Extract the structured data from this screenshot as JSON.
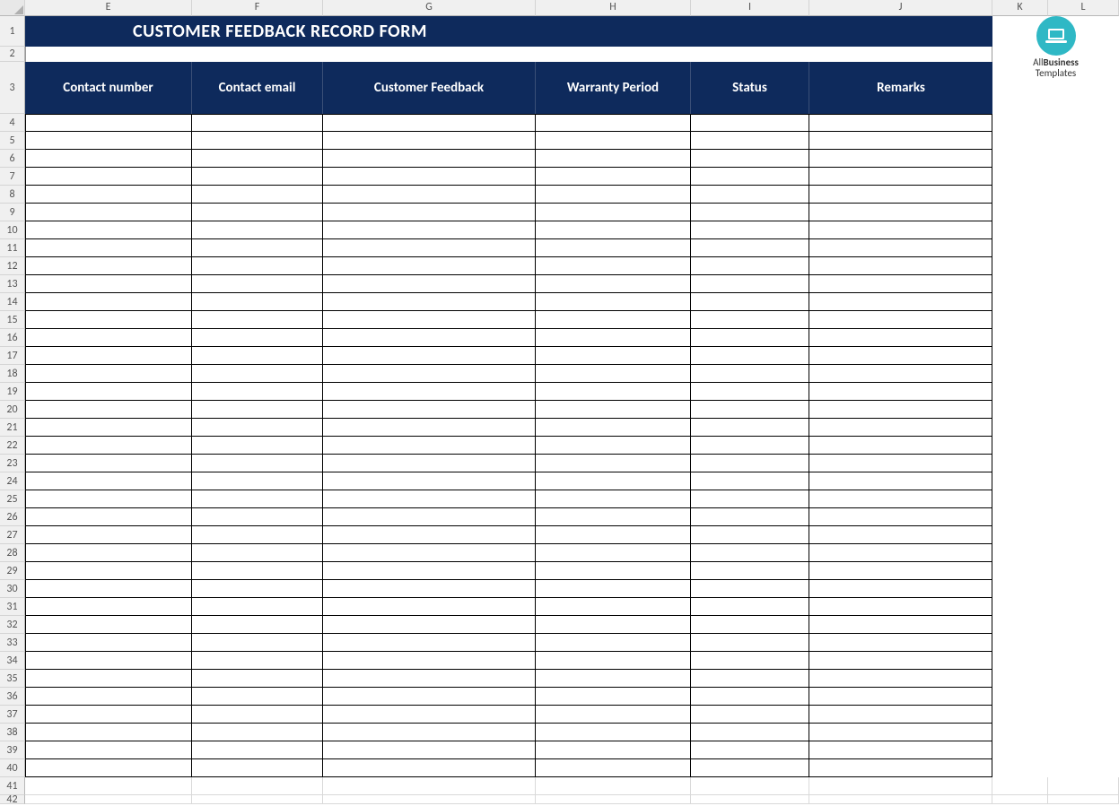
{
  "title": "CUSTOMER FEEDBACK RECORD FORM",
  "columns_letters": [
    "E",
    "F",
    "G",
    "H",
    "I",
    "J",
    "K",
    "L"
  ],
  "row_numbers": [
    "1",
    "2",
    "3",
    "4",
    "5",
    "6",
    "7",
    "8",
    "9",
    "10",
    "11",
    "12",
    "13",
    "14",
    "15",
    "16",
    "17",
    "18",
    "19",
    "20",
    "21",
    "22",
    "23",
    "24",
    "25",
    "26",
    "27",
    "28",
    "29",
    "30",
    "31",
    "32",
    "33",
    "34",
    "35",
    "36",
    "37",
    "38",
    "39",
    "40",
    "41",
    "42"
  ],
  "headers": {
    "contact_number": "Contact number",
    "contact_email": "Contact email",
    "customer_feedback": "Customer Feedback",
    "warranty_period": "Warranty Period",
    "status": "Status",
    "remarks": "Remarks"
  },
  "logo": {
    "line1a": "All",
    "line1b": "Business",
    "line2": "Templates"
  },
  "colors": {
    "brand_blue": "#0e2a5c",
    "logo_teal": "#2fb8c5"
  }
}
